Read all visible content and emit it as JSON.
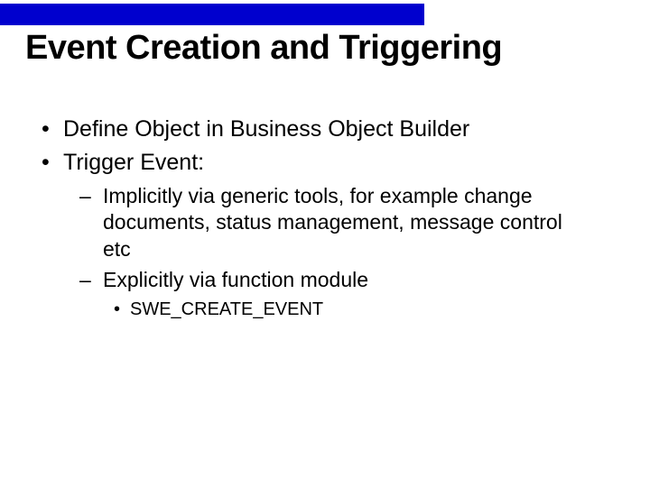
{
  "title": "Event Creation and Triggering",
  "bullets": {
    "b1": "Define Object in Business Object Builder",
    "b2": "Trigger Event:",
    "b2_sub1": "Implicitly via generic tools, for example change documents, status management, message control etc",
    "b2_sub2": "Explicitly via function module",
    "b2_sub2_a": "SWE_CREATE_EVENT"
  }
}
